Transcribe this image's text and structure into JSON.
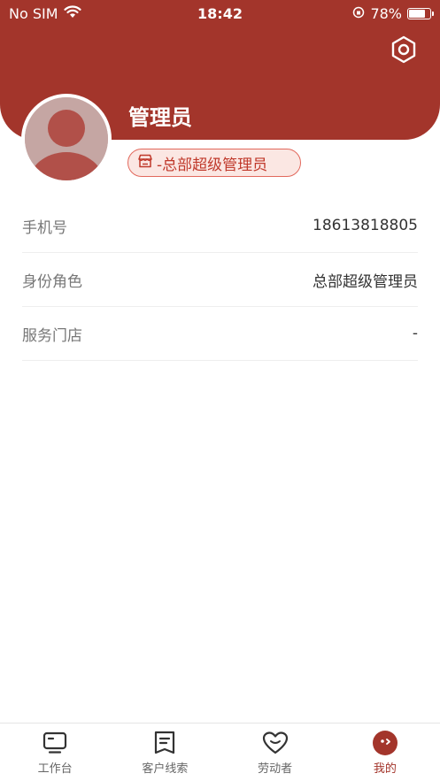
{
  "status_bar": {
    "carrier": "No SIM",
    "time": "18:42",
    "battery": "78%",
    "battery_level": 0.78
  },
  "profile": {
    "name": "管理员",
    "role_badge": "-总部超级管理员"
  },
  "info": [
    {
      "label": "手机号",
      "value": "18613818805"
    },
    {
      "label": "身份角色",
      "value": "总部超级管理员"
    },
    {
      "label": "服务门店",
      "value": "-"
    }
  ],
  "tabs": [
    {
      "label": "工作台",
      "icon": "monitor-icon"
    },
    {
      "label": "客户线索",
      "icon": "receipt-icon"
    },
    {
      "label": "劳动者",
      "icon": "heart-icon"
    },
    {
      "label": "我的",
      "icon": "face-icon",
      "active": true
    }
  ],
  "colors": {
    "primary": "#a3352b",
    "badge_bg": "#fbe7e3",
    "badge_border": "#e2685c"
  }
}
